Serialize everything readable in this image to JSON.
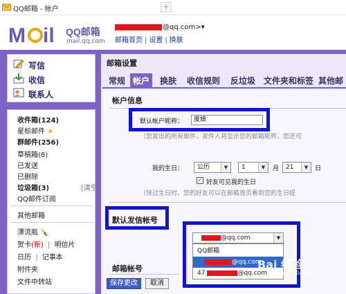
{
  "titlebar": {
    "title": "QQ邮箱 - 帐户",
    "new_tab": "+"
  },
  "header": {
    "brand": "QQ邮箱",
    "brand_sub": "mail.qq.com",
    "account_suffix": "@qq.com>▾",
    "links": [
      "邮箱首页",
      "设置",
      "换肤"
    ]
  },
  "nav": [
    {
      "label": "写信",
      "icon": "pencil-icon"
    },
    {
      "label": "收信",
      "icon": "inbox-icon"
    },
    {
      "label": "联系人",
      "icon": "contacts-icon"
    }
  ],
  "folders": {
    "inbox": "收件箱(124)",
    "starred": "星标邮件",
    "group": "群邮件(256)",
    "drafts": "草稿箱(8)",
    "sent": "已发送",
    "deleted": "已删除",
    "spam": "垃圾箱(3)",
    "clear": "[清空]",
    "subscribe": "QQ邮件订阅",
    "other": "其他邮箱",
    "drift": "漂流瓶",
    "card": "贺卡",
    "card_new": "(新)",
    "postcard": "明信片",
    "calendar": "日历",
    "notepad": "记事本",
    "attachments": "附件夹",
    "transfer": "文件中转站"
  },
  "main": {
    "title": "邮箱设置",
    "tabs": [
      "常规",
      "帐户",
      "换肤",
      "收信规则",
      "反垃圾",
      "文件夹和标签",
      "其他邮"
    ],
    "active_tab": 1,
    "section_account": "帐户信息",
    "nickname_label": "默认帐户昵称：",
    "nickname_value": "度娘",
    "nickname_hint": "（您发出的所有邮件，发件人将显示您的邮箱昵称，您还可",
    "birthday_label": "我的生日：",
    "calendar_value": "公历",
    "month_value": "1",
    "month_unit": "月",
    "day_value": "21",
    "day_unit": "日",
    "birthday_visible_label": "好友可见我的生日",
    "birthday_hint": "（快过生日时，您的好友可以在邮箱首页看到您的生日提",
    "section_default_sender": "默认发信帐号",
    "sender_selected_suffix": "@qq.com",
    "dropdown_options": [
      "QQ邮箱",
      "@qq.com",
      "@qq.com"
    ],
    "option3_prefix": "47",
    "section_mailbox": "邮箱帐号",
    "save_button": "保存更改",
    "cancel_button": "取消"
  },
  "watermark": {
    "text": "Bai 经验",
    "sub": "jingyan.baidu.com"
  },
  "colors": {
    "frame": "#7d64c4",
    "highlight_box": "#1414c8",
    "redaction": "#e0171b",
    "selection": "#3169c6"
  }
}
